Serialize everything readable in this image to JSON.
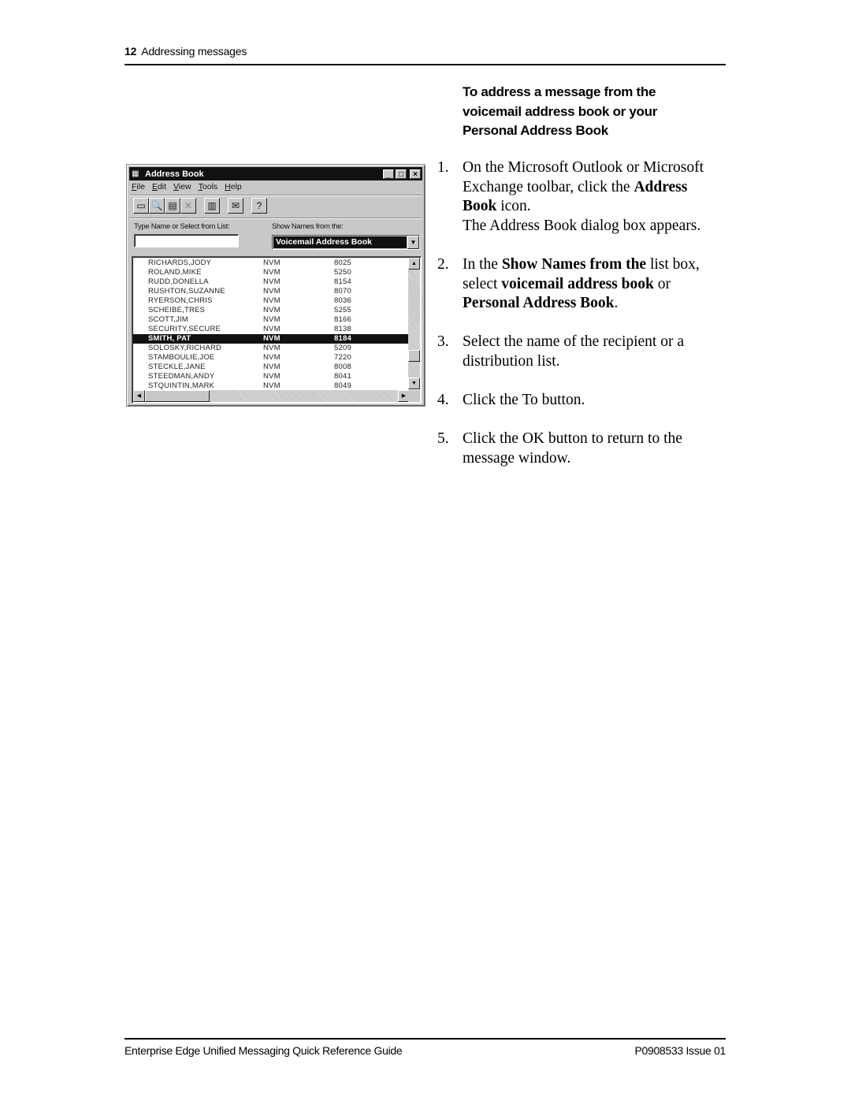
{
  "header": {
    "page_number": "12",
    "section_title": "Addressing messages"
  },
  "procedure": {
    "heading": "To address a message from the voicemail address book or your Personal Address Book",
    "steps": [
      {
        "number": "1.",
        "parts": [
          {
            "text": "On the Microsoft Outlook or Microsoft Exchange toolbar, click the ",
            "bold": false
          },
          {
            "text": "Address Book",
            "bold": true
          },
          {
            "text": " icon.",
            "bold": false
          }
        ],
        "result": "The Address Book dialog box appears."
      },
      {
        "number": "2.",
        "parts": [
          {
            "text": "In the ",
            "bold": false
          },
          {
            "text": "Show Names from the",
            "bold": true
          },
          {
            "text": " list box, select ",
            "bold": false
          },
          {
            "text": "voicemail address book",
            "bold": true
          },
          {
            "text": " or ",
            "bold": false
          },
          {
            "text": "Personal Address Book",
            "bold": true
          },
          {
            "text": ".",
            "bold": false
          }
        ]
      },
      {
        "number": "3.",
        "parts": [
          {
            "text": "Select the name of the recipient or a distribution list.",
            "bold": false
          }
        ]
      },
      {
        "number": "4.",
        "parts": [
          {
            "text": "Click the To button.",
            "bold": false
          }
        ]
      },
      {
        "number": "5.",
        "parts": [
          {
            "text": "Click the OK button to return to the message window.",
            "bold": false
          }
        ]
      }
    ]
  },
  "address_book_window": {
    "title": "Address Book",
    "title_icon": "address-book-icon",
    "window_buttons": {
      "minimize": "_",
      "maximize": "□",
      "close": "×"
    },
    "menu": [
      {
        "label": "File",
        "accel": "F",
        "rest": "ile"
      },
      {
        "label": "Edit",
        "accel": "E",
        "rest": "dit"
      },
      {
        "label": "View",
        "accel": "V",
        "rest": "iew"
      },
      {
        "label": "Tools",
        "accel": "T",
        "rest": "ools"
      },
      {
        "label": "Help",
        "accel": "H",
        "rest": "elp"
      }
    ],
    "toolbar": [
      {
        "name": "new-message-icon",
        "glyph": "▭",
        "disabled": false
      },
      {
        "name": "find-icon",
        "glyph": "🔍",
        "disabled": false
      },
      {
        "name": "properties-icon",
        "glyph": "▤",
        "disabled": false
      },
      {
        "name": "delete-icon",
        "glyph": "✕",
        "disabled": true
      },
      {
        "name": "add-to-personal-address-book-icon",
        "glyph": "▥",
        "disabled": false,
        "gap_before": true
      },
      {
        "name": "new-entry-icon",
        "glyph": "✉",
        "disabled": false,
        "gap_before": true
      },
      {
        "name": "help-pointer-icon",
        "glyph": "?",
        "disabled": false,
        "gap_before": true
      }
    ],
    "type_name_label": "Type Name or Select from List:",
    "type_name_value": "",
    "show_names_label": "Show Names from the:",
    "show_names_value": "Voicemail Address Book",
    "entries": [
      {
        "name": "RICHARDS,JODY",
        "type": "NVM",
        "ext": "8025",
        "selected": false
      },
      {
        "name": "ROLAND,MIKE",
        "type": "NVM",
        "ext": "5250",
        "selected": false
      },
      {
        "name": "RUDD,DONELLA",
        "type": "NVM",
        "ext": "8154",
        "selected": false
      },
      {
        "name": "RUSHTON,SUZANNE",
        "type": "NVM",
        "ext": "8070",
        "selected": false
      },
      {
        "name": "RYERSON,CHRIS",
        "type": "NVM",
        "ext": "8036",
        "selected": false
      },
      {
        "name": "SCHEIBE,TRES",
        "type": "NVM",
        "ext": "5255",
        "selected": false
      },
      {
        "name": "SCOTT,JIM",
        "type": "NVM",
        "ext": "8166",
        "selected": false
      },
      {
        "name": "SECURITY,SECURE",
        "type": "NVM",
        "ext": "8138",
        "selected": false
      },
      {
        "name": "SMITH, PAT",
        "type": "NVM",
        "ext": "8184",
        "selected": true
      },
      {
        "name": "SOLOSKY,RICHARD",
        "type": "NVM",
        "ext": "5209",
        "selected": false
      },
      {
        "name": "STAMBOULIE,JOE",
        "type": "NVM",
        "ext": "7220",
        "selected": false
      },
      {
        "name": "STECKLE,JANE",
        "type": "NVM",
        "ext": "8008",
        "selected": false
      },
      {
        "name": "STEEDMAN,ANDY",
        "type": "NVM",
        "ext": "8041",
        "selected": false
      },
      {
        "name": "STQUINTIN,MARK",
        "type": "NVM",
        "ext": "8049",
        "selected": false
      }
    ]
  },
  "footer": {
    "guide_title": "Enterprise Edge Unified Messaging Quick Reference Guide",
    "doc_id": "P0908533 Issue 01"
  }
}
